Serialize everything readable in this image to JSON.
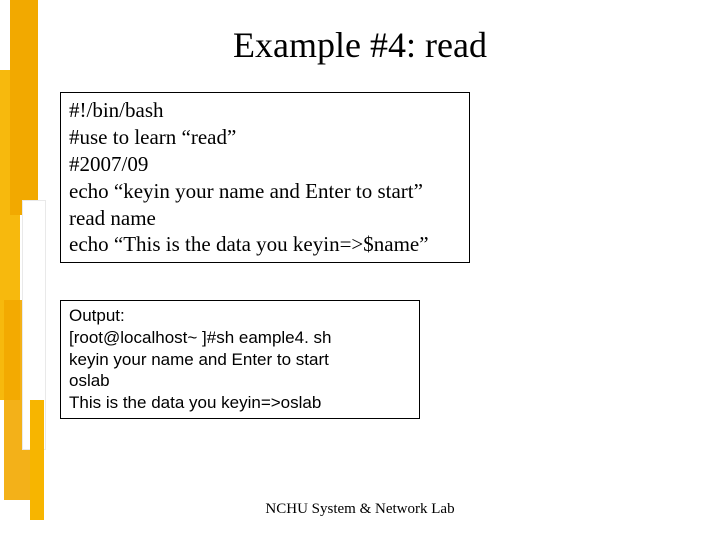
{
  "title": "Example #4: read",
  "code": {
    "lines": [
      "#!/bin/bash",
      "#use to learn “read”",
      "#2007/09",
      "echo “keyin your name and Enter to start”",
      "read name",
      "echo “This is the data you keyin=>$name”"
    ]
  },
  "output": {
    "lines": [
      "Output:",
      "[root@localhost~ ]#sh eample4. sh",
      "keyin your name and Enter to start",
      "oslab",
      "This is the data you keyin=>oslab"
    ]
  },
  "footer": "NCHU System & Network Lab"
}
